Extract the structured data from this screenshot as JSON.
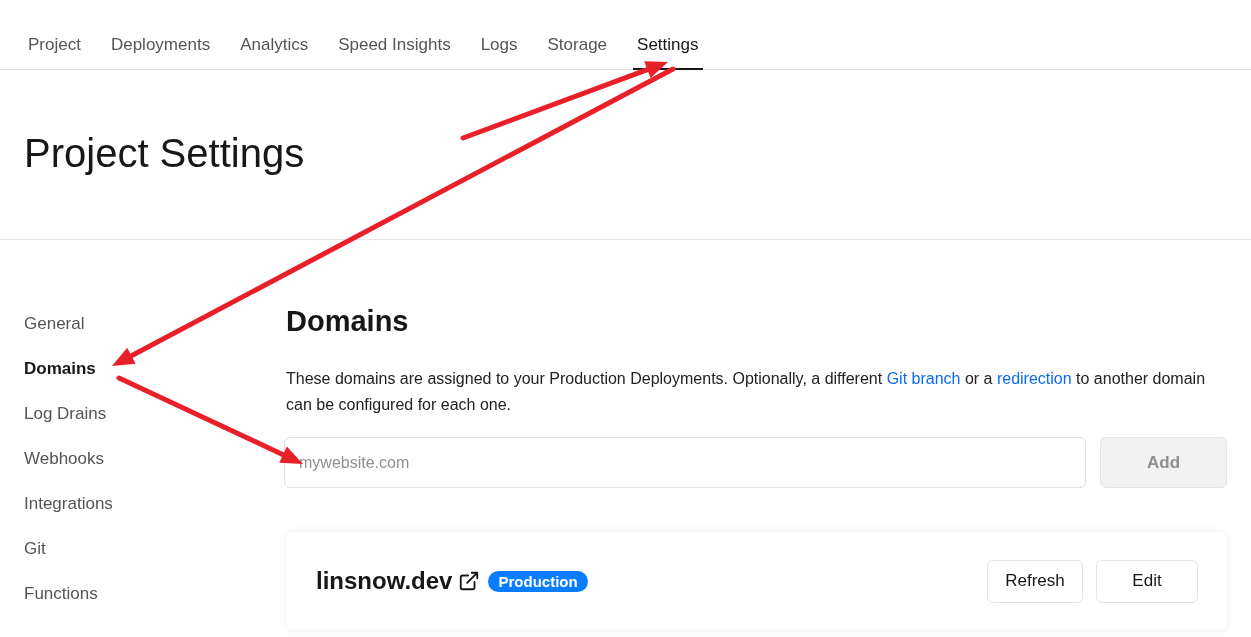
{
  "tabs": [
    {
      "label": "Project",
      "selected": false
    },
    {
      "label": "Deployments",
      "selected": false
    },
    {
      "label": "Analytics",
      "selected": false
    },
    {
      "label": "Speed Insights",
      "selected": false
    },
    {
      "label": "Logs",
      "selected": false
    },
    {
      "label": "Storage",
      "selected": false
    },
    {
      "label": "Settings",
      "selected": true
    }
  ],
  "page_title": "Project Settings",
  "sidebar": {
    "items": [
      {
        "label": "General",
        "selected": false
      },
      {
        "label": "Domains",
        "selected": true
      },
      {
        "label": "Log Drains",
        "selected": false
      },
      {
        "label": "Webhooks",
        "selected": false
      },
      {
        "label": "Integrations",
        "selected": false
      },
      {
        "label": "Git",
        "selected": false
      },
      {
        "label": "Functions",
        "selected": false
      }
    ]
  },
  "domains": {
    "heading": "Domains",
    "description": [
      {
        "kind": "text",
        "text": "These domains are assigned to your Production Deployments. Optionally, a different "
      },
      {
        "kind": "link",
        "text": "Git branch"
      },
      {
        "kind": "text",
        "text": " or a "
      },
      {
        "kind": "link",
        "text": "redirection"
      },
      {
        "kind": "text",
        "text": " to another domain can be configured for each one."
      }
    ],
    "input": {
      "placeholder": "mywebsite.com"
    },
    "add_button": {
      "label": "Add",
      "disabled": true
    },
    "card": {
      "domain": "linsnow.dev",
      "badge": "Production",
      "buttons": [
        "Refresh",
        "Edit"
      ]
    }
  }
}
